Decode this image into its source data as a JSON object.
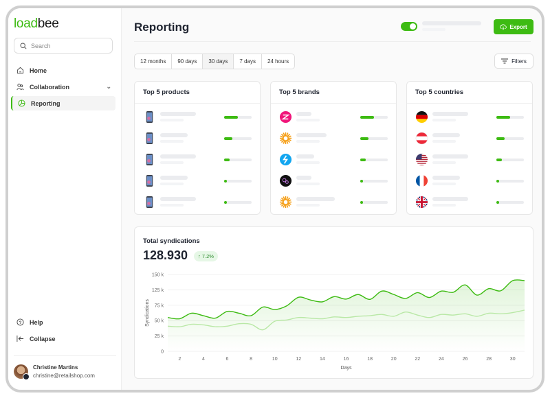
{
  "app": {
    "logo_part1": "load",
    "logo_part2": "bee"
  },
  "sidebar": {
    "search_placeholder": "Search",
    "items": [
      {
        "label": "Home",
        "icon": "home-icon"
      },
      {
        "label": "Collaboration",
        "icon": "users-icon"
      },
      {
        "label": "Reporting",
        "icon": "pie-chart-icon",
        "active": true
      }
    ],
    "help": "Help",
    "collapse": "Collapse",
    "user": {
      "name": "Christine Martins",
      "email": "christine@retailshop.com"
    }
  },
  "header": {
    "title": "Reporting",
    "toggle_on": true,
    "export_label": "Export"
  },
  "ranges": {
    "options": [
      "12 months",
      "90 days",
      "30 days",
      "7 days",
      "24 hours"
    ],
    "selected": "30 days"
  },
  "filters_label": "Filters",
  "colors": {
    "accent": "#3dbb12",
    "accent_light": "#b9e8a6"
  },
  "cards": [
    {
      "title": "Top 5 products",
      "items": [
        {
          "icon": "phone-product-image",
          "share": 0.5
        },
        {
          "icon": "phone-product-image",
          "share": 0.3
        },
        {
          "icon": "phone-product-image",
          "share": 0.2
        },
        {
          "icon": "phone-product-image",
          "share": 0.05
        },
        {
          "icon": "phone-product-image",
          "share": 0.05
        }
      ]
    },
    {
      "title": "Top 5 brands",
      "items": [
        {
          "icon": "brand-logo-pink",
          "share": 0.5
        },
        {
          "icon": "brand-logo-orange-sun",
          "share": 0.3
        },
        {
          "icon": "brand-logo-blue",
          "share": 0.2
        },
        {
          "icon": "brand-logo-black",
          "share": 0.05
        },
        {
          "icon": "brand-logo-orange-sun",
          "share": 0.05
        }
      ]
    },
    {
      "title": "Top 5 countries",
      "items": [
        {
          "icon": "flag-germany",
          "share": 0.5
        },
        {
          "icon": "flag-austria",
          "share": 0.3
        },
        {
          "icon": "flag-usa",
          "share": 0.2
        },
        {
          "icon": "flag-france",
          "share": 0.05
        },
        {
          "icon": "flag-uk",
          "share": 0.05
        }
      ]
    }
  ],
  "syndications": {
    "title": "Total syndications",
    "value": "128.930",
    "change": "7.2%",
    "change_direction": "up"
  },
  "chart_data": {
    "type": "area",
    "xlabel": "Days",
    "ylabel": "Syndications",
    "y_ticks": [
      "0",
      "25 k",
      "50 k",
      "75 k",
      "125 k",
      "150 k"
    ],
    "x_ticks": [
      "2",
      "4",
      "6",
      "8",
      "10",
      "12",
      "14",
      "16",
      "18",
      "20",
      "22",
      "24",
      "26",
      "28",
      "30"
    ],
    "x": [
      1,
      2,
      3,
      4,
      5,
      6,
      7,
      8,
      9,
      10,
      11,
      12,
      13,
      14,
      15,
      16,
      17,
      18,
      19,
      20,
      21,
      22,
      23,
      24,
      25,
      26,
      27,
      28,
      29,
      30,
      31
    ],
    "series": [
      {
        "color": "#3dbb12",
        "values_k": [
          55,
          53,
          62,
          58,
          54,
          65,
          62,
          58,
          72,
          68,
          74,
          101,
          92,
          86,
          103,
          95,
          110,
          94,
          121,
          110,
          97,
          116,
          100,
          121,
          117,
          133,
          108,
          127,
          122,
          140,
          140
        ]
      },
      {
        "color": "#b9e8a6",
        "values_k": [
          41,
          40,
          44,
          43,
          40,
          41,
          45,
          44,
          35,
          49,
          51,
          55,
          54,
          53,
          56,
          55,
          57,
          58,
          60,
          57,
          64,
          59,
          55,
          60,
          59,
          61,
          57,
          62,
          61,
          63,
          67
        ]
      }
    ],
    "grid": true
  }
}
